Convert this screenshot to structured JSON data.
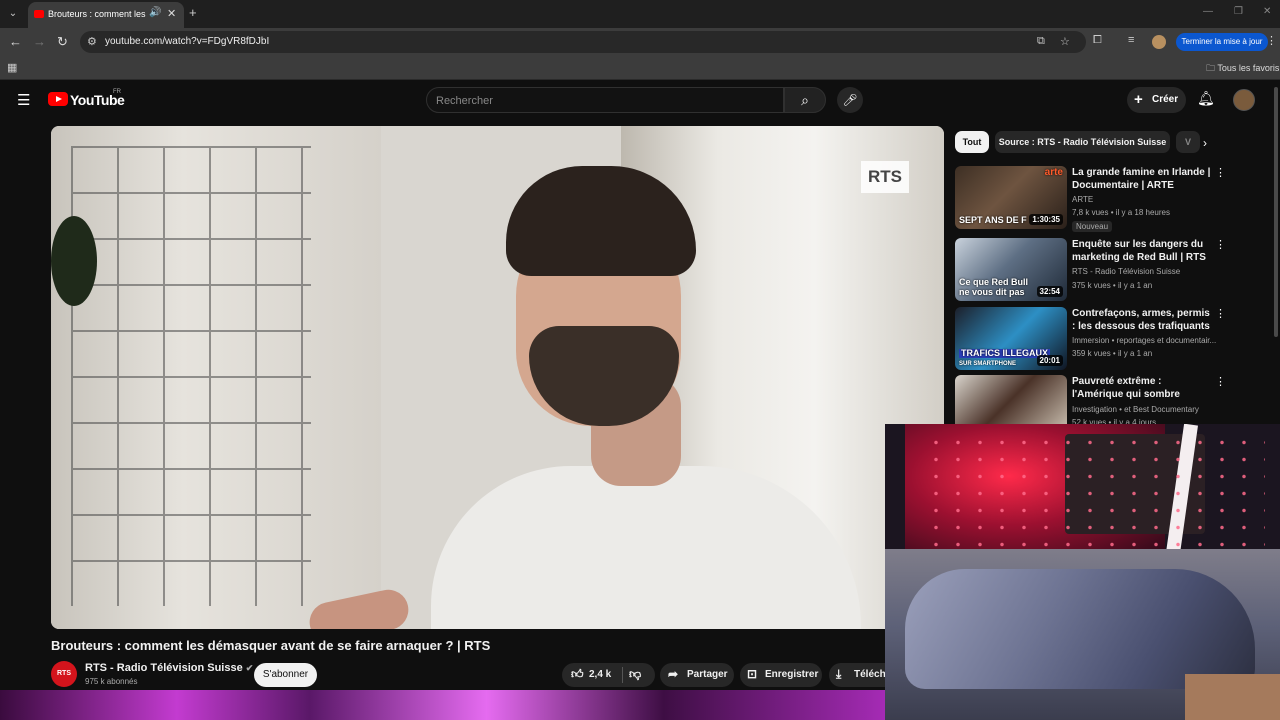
{
  "browser": {
    "tab_title": "Brouteurs : comment les dé",
    "url": "youtube.com/watch?v=FDgVR8fDJbI",
    "update_button": "Terminer la mise à jour",
    "bookmarks_folder": "Tous les favoris"
  },
  "youtube": {
    "wordmark": "YouTube",
    "country_code": "FR",
    "search_placeholder": "Rechercher",
    "create_label": "Créer"
  },
  "video": {
    "watermark": "RTS",
    "title": "Brouteurs : comment les démasquer avant de se faire arnaquer ? | RTS",
    "channel_avatar_text": "RTS",
    "channel_name": "RTS - Radio Télévision Suisse",
    "subscribers": "975 k abonnés",
    "subscribe_label": "S'abonner",
    "likes": "2,4 k",
    "share_label": "Partager",
    "save_label": "Enregistrer",
    "download_label": "Téléchar"
  },
  "chips": [
    "Tout",
    "Source : RTS - Radio Télévision Suisse",
    "V"
  ],
  "recommendations": [
    {
      "title": "La grande famine en Irlande | Documentaire | ARTE",
      "channel": "ARTE",
      "stats": "7,8 k vues • il y a 18 heures",
      "badge": "Nouveau",
      "thumb_text": "SEPT ANS DE F",
      "thumb_brand": "arte",
      "duration": "1:30:35"
    },
    {
      "title": "Enquête sur les dangers du marketing de Red Bull  | RTS",
      "channel": "RTS - Radio Télévision Suisse",
      "stats": "375 k vues • il y a 1 an",
      "thumb_text": "Ce que Red Bull ne vous dit pas",
      "duration": "32:54"
    },
    {
      "title": "Contrefaçons, armes, permis : les dessous des trafiquants",
      "channel": "Immersion • reportages et documentair...",
      "stats": "359 k vues • il y a 1 an",
      "thumb_text": "TRAFICS ILLEGAUX",
      "thumb_subtext": "SUR SMARTPHONE",
      "duration": "20:01"
    },
    {
      "title": "Pauvreté extrême : l'Amérique qui sombre",
      "channel": "Investigation • et Best Documentary",
      "stats": "52 k vues • il y a 4 jours"
    }
  ],
  "colors": {
    "brand_red": "#ff0000",
    "background": "#0f0f0f",
    "update_blue": "#0b57d0"
  },
  "icons": [
    "chevron-down-icon",
    "speaker-icon",
    "close-icon",
    "plus-icon",
    "back-icon",
    "forward-icon",
    "reload-icon",
    "site-info-icon",
    "install-icon",
    "star-icon",
    "extensions-icon",
    "media-icon",
    "kebab-icon",
    "apps-icon",
    "folder-icon",
    "hamburger-icon",
    "search-icon",
    "mic-icon",
    "bell-icon",
    "thumbs-up-icon",
    "thumbs-down-icon",
    "share-icon",
    "save-icon",
    "download-icon",
    "verified-icon"
  ]
}
